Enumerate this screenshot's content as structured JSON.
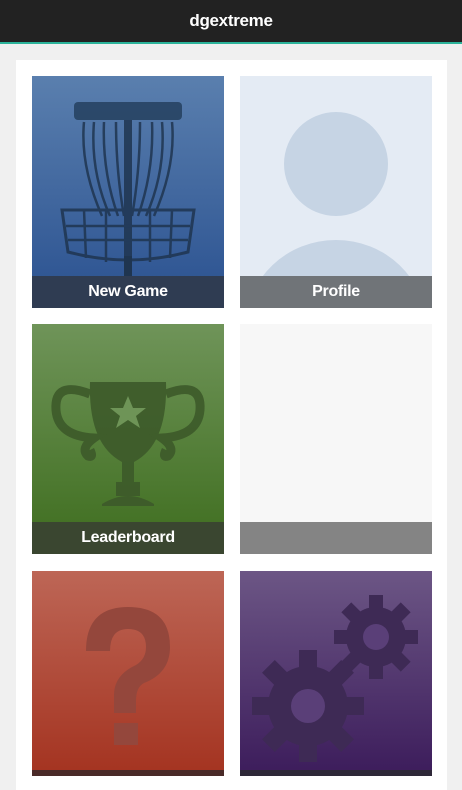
{
  "header": {
    "title": "dgextreme"
  },
  "tiles": [
    {
      "label": "New Game",
      "icon": "disc-golf-basket-icon"
    },
    {
      "label": "Profile",
      "icon": "user-avatar-icon"
    },
    {
      "label": "Leaderboard",
      "icon": "trophy-icon"
    },
    {
      "label": "",
      "icon": ""
    },
    {
      "label": "",
      "icon": "question-mark-icon"
    },
    {
      "label": "",
      "icon": "gears-icon"
    }
  ],
  "colors": {
    "header_bg": "#222222",
    "accent": "#2bb39a",
    "new_game": "#2a5190",
    "profile": "#e4ebf4",
    "leaderboard": "#3e6d1e",
    "help": "#a43320",
    "settings": "#3c1c5b"
  }
}
